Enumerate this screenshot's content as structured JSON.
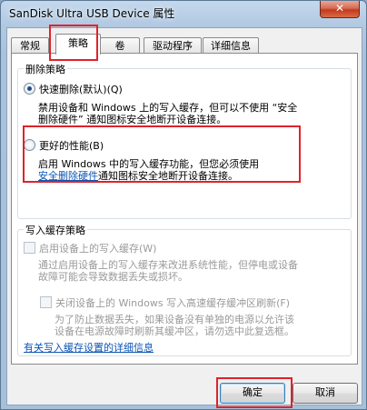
{
  "window": {
    "title": "SanDisk Ultra USB Device 属性",
    "close_glyph": "✕"
  },
  "tabs": [
    {
      "label": "常规"
    },
    {
      "label": "策略",
      "active": true
    },
    {
      "label": "卷"
    },
    {
      "label": "驱动程序"
    },
    {
      "label": "详细信息"
    }
  ],
  "removal_policy": {
    "title": "删除策略",
    "quick_removal": {
      "label": "快速删除(默认)(Q)",
      "checked": true,
      "desc_line1": "禁用设备和 Windows 上的写入缓存，但可以不使用 “安全",
      "desc_line2": "删除硬件” 通知图标安全地断开设备连接。"
    },
    "better_performance": {
      "label": "更好的性能(B)",
      "checked": false,
      "desc_line1": "启用 Windows 中的写入缓存功能，但您必须使用",
      "desc_link": "安全删除硬件",
      "desc_line2_rest": "通知图标安全地断开设备连接。"
    }
  },
  "write_cache_policy": {
    "title": "写入缓存策略",
    "enable_cache": {
      "label": "启用设备上的写入缓存(W)",
      "desc_line1": "通过启用设备上的写入缓存来改进系统性能，但停电或设备",
      "desc_line2": "故障可能会导致数据丢失或损坏。"
    },
    "disable_flush": {
      "label": "关闭设备上的 Windows 写入高速缓存缓冲区刷新(F)",
      "desc_line1": "为了防止数据丢失，如果设备没有单独的电源以允许该",
      "desc_line2": "设备在电源故障时刷新其缓冲区，请勿选中此复选框。"
    }
  },
  "more_info_link": "有关写入缓存设置的详细信息",
  "buttons": {
    "ok": "确定",
    "cancel": "取消"
  },
  "colors": {
    "highlight_border": "#e0222a",
    "link": "#0b55b5",
    "disabled_text": "#9a9a9a"
  }
}
